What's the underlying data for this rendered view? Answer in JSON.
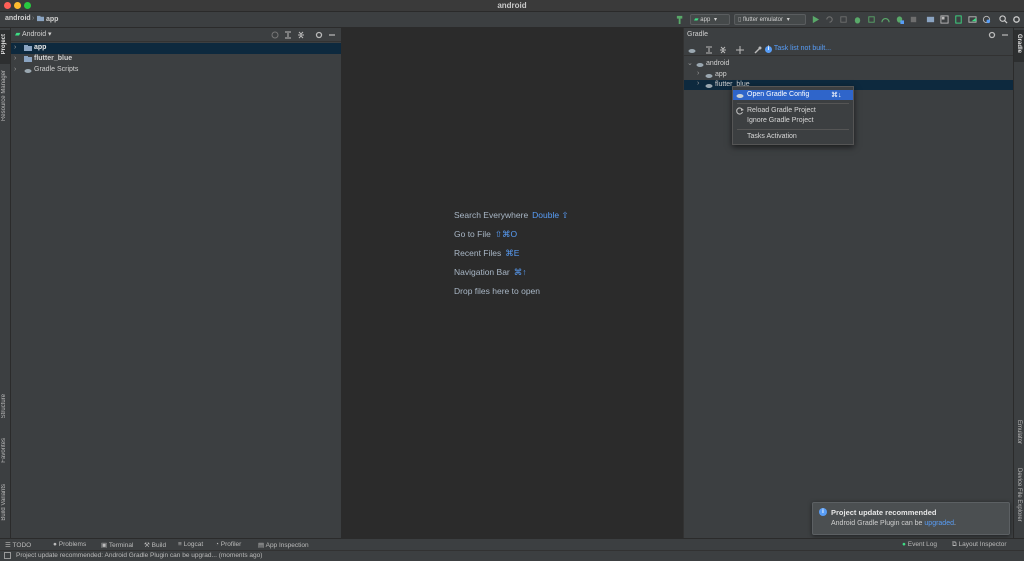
{
  "window": {
    "title": "android"
  },
  "navbar": {
    "breadcrumbs": [
      "android",
      "app"
    ],
    "run_config": "app",
    "device": "flutter emulator"
  },
  "left_stripe": {
    "tabs": [
      "Project",
      "Resource Manager",
      "Structure",
      "Favorites",
      "Build Variants"
    ]
  },
  "project": {
    "view_mode": "Android",
    "items": [
      {
        "label": "app",
        "selected": true
      },
      {
        "label": "flutter_blue",
        "selected": false
      },
      {
        "label": "Gradle Scripts",
        "selected": false
      }
    ]
  },
  "editor": {
    "hints": [
      {
        "label": "Search Everywhere",
        "shortcut": "Double ⇧"
      },
      {
        "label": "Go to File",
        "shortcut": "⇧⌘O"
      },
      {
        "label": "Recent Files",
        "shortcut": "⌘E"
      },
      {
        "label": "Navigation Bar",
        "shortcut": "⌘↑"
      },
      {
        "label": "Drop files here to open",
        "shortcut": ""
      }
    ]
  },
  "gradle": {
    "title": "Gradle",
    "task_list_text": "Task list not built...",
    "tree": {
      "root": "android",
      "children": [
        "app",
        "flutter_blue"
      ]
    }
  },
  "context_menu": {
    "items": [
      {
        "label": "Open Gradle Config",
        "shortcut": "⌘↓"
      },
      {
        "label": "Reload Gradle Project"
      },
      {
        "label": "Ignore Gradle Project"
      },
      {
        "label": "Tasks Activation"
      }
    ]
  },
  "right_stripe": {
    "tabs": [
      "Gradle",
      "Emulator",
      "Device File Explorer"
    ]
  },
  "notification": {
    "title": "Project update recommended",
    "body_prefix": "Android Gradle Plugin can be ",
    "link": "upgraded",
    "body_suffix": "."
  },
  "bottom_tools": {
    "left": [
      "TODO",
      "Problems",
      "Terminal",
      "Build",
      "Logcat",
      "Profiler",
      "App Inspection"
    ],
    "right": [
      "Event Log",
      "Layout Inspector"
    ]
  },
  "status": {
    "message": "Project update recommended: Android Gradle Plugin can be upgrad... (moments ago)"
  },
  "colors": {
    "accent": "#589df6",
    "selection": "#0d293e",
    "menu_highlight": "#2f65ca",
    "run_green": "#59a869",
    "android_green": "#3ddc84"
  }
}
